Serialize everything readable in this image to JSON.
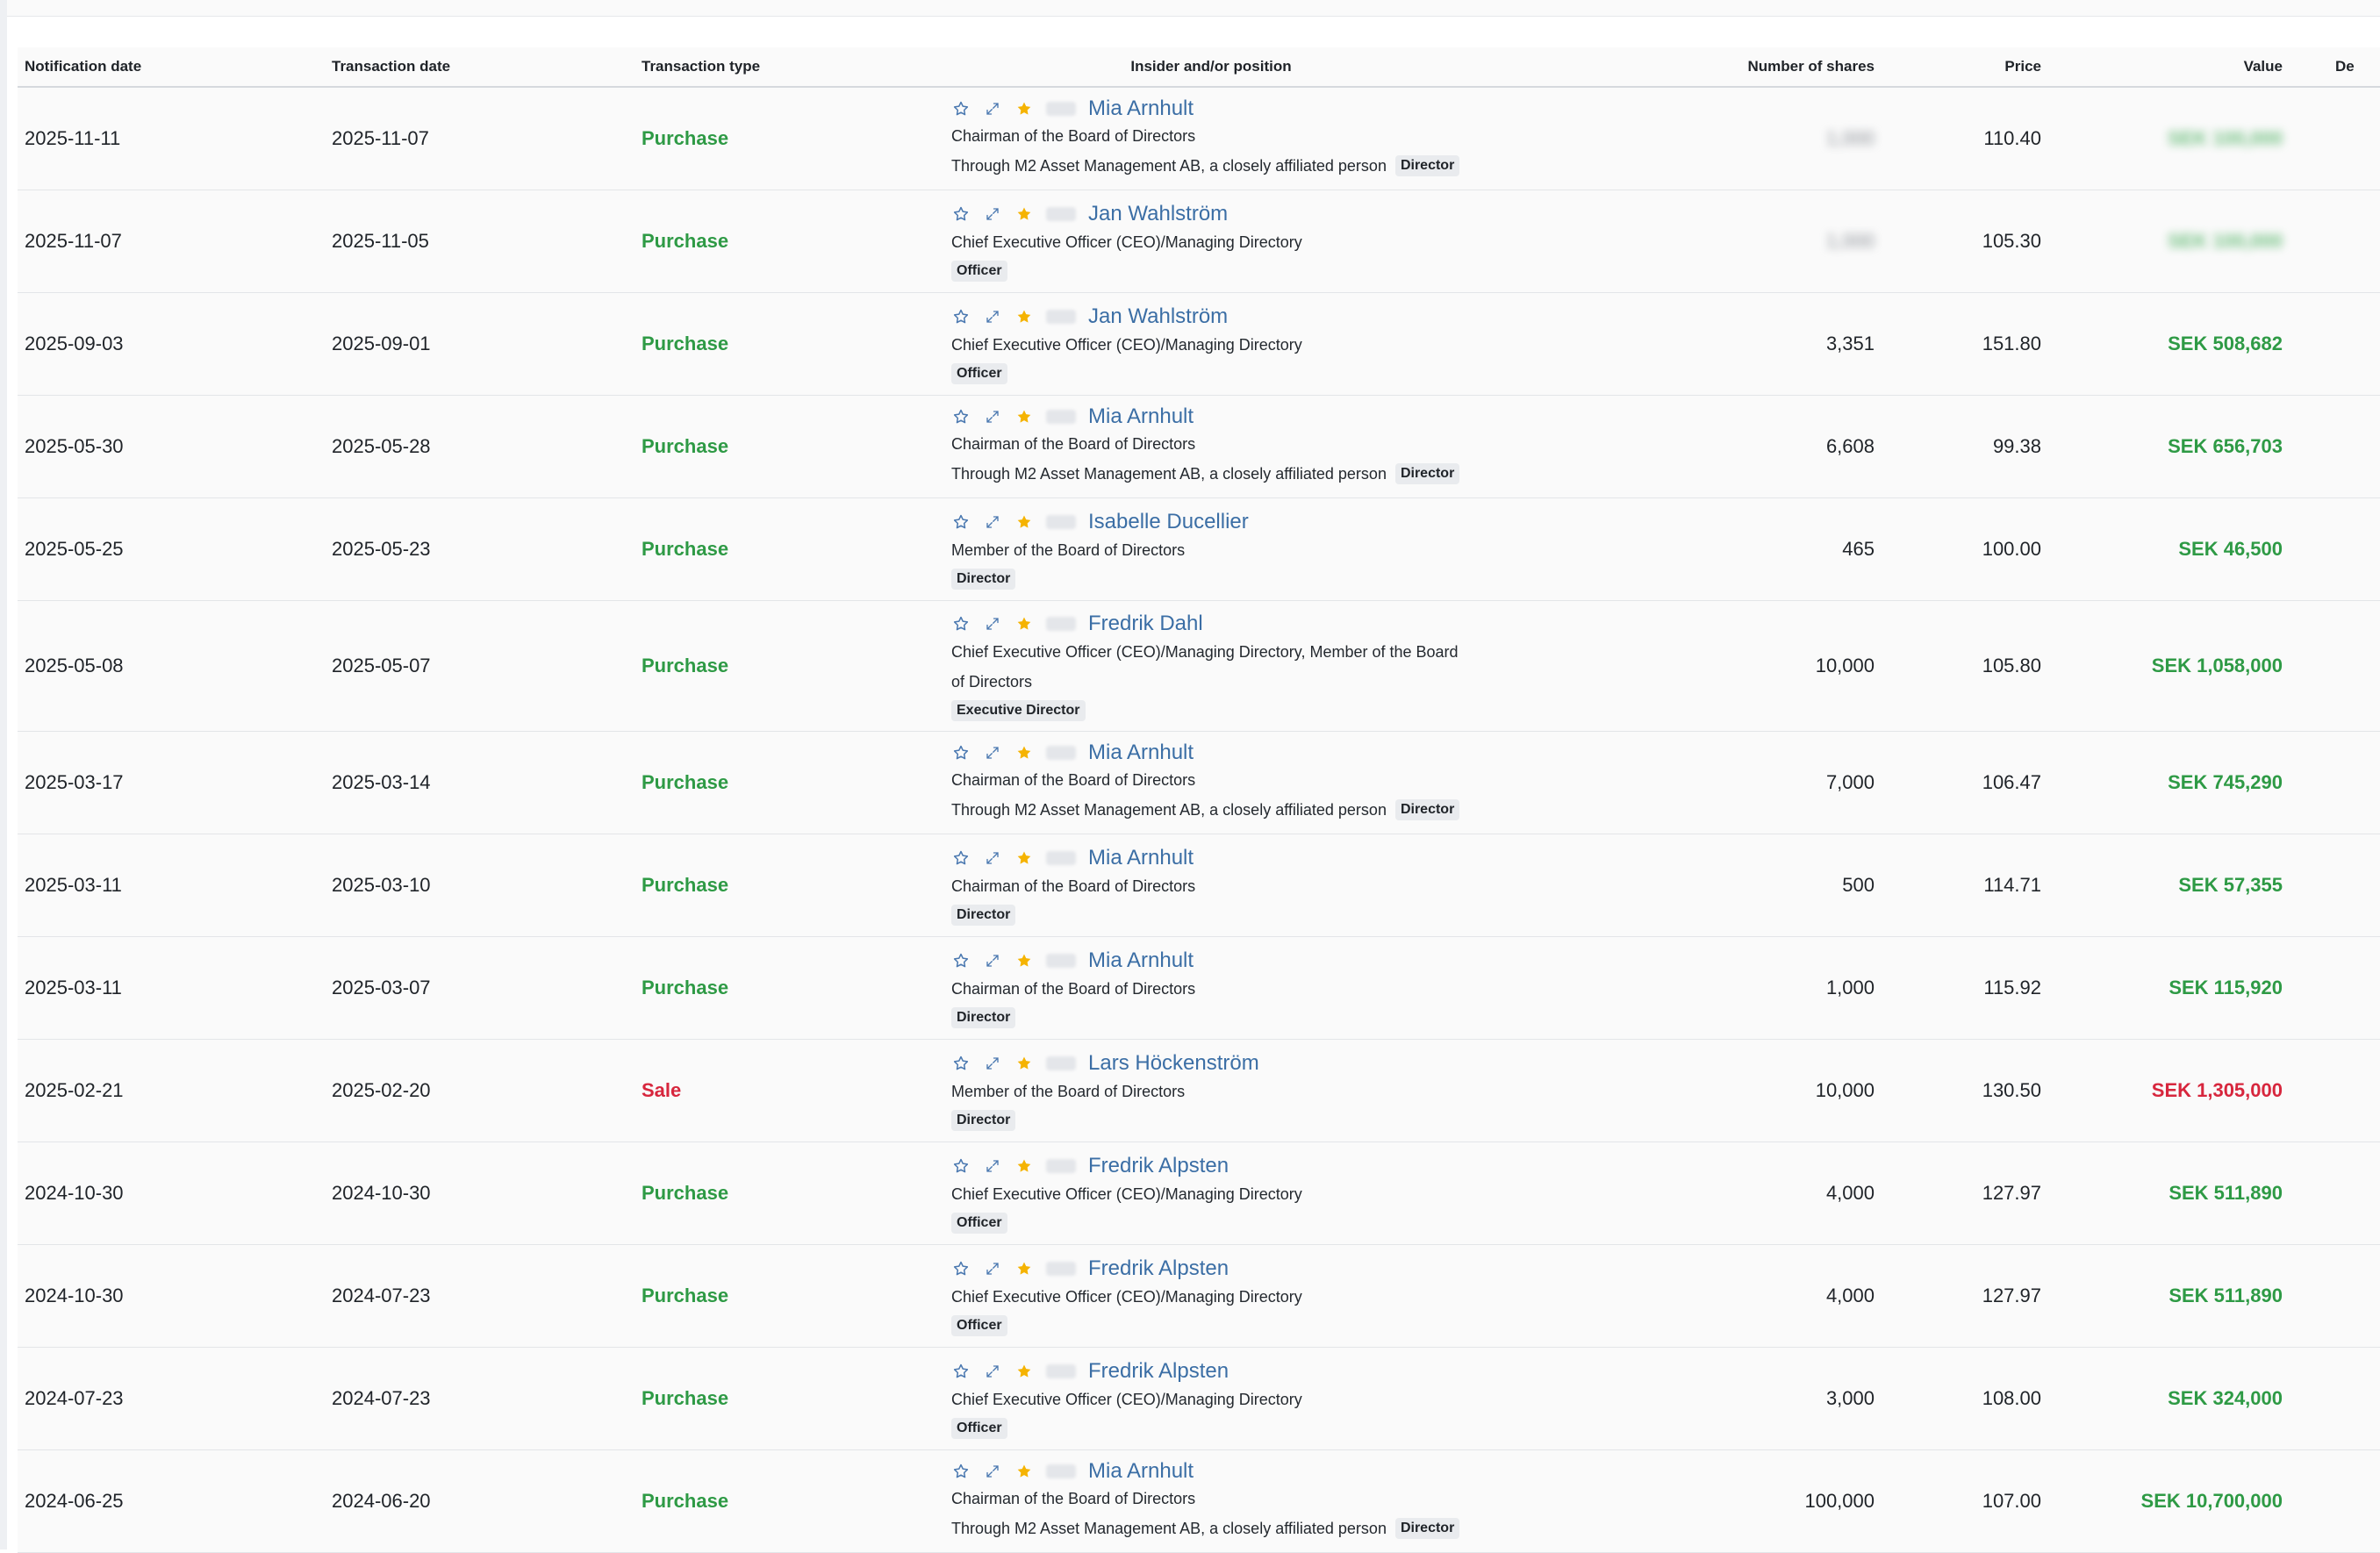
{
  "table": {
    "columns": {
      "notification_date": "Notification date",
      "transaction_date": "Transaction date",
      "transaction_type": "Transaction type",
      "insider": "Insider and/or position",
      "shares": "Number of shares",
      "price": "Price",
      "value": "Value",
      "extra": "De"
    },
    "rows": [
      {
        "notif": "2025-11-11",
        "trans": "2025-11-07",
        "type": "Purchase",
        "name": "Mia Arnhult",
        "position": "Chairman of the Board of Directors",
        "note": "Through M2 Asset Management AB, a closely affiliated person",
        "tag": "Director",
        "shares": "1,000",
        "price": "110.40",
        "value": "SEK 100,000",
        "blurred": true
      },
      {
        "notif": "2025-11-07",
        "trans": "2025-11-05",
        "type": "Purchase",
        "name": "Jan Wahlström",
        "position": "Chief Executive Officer (CEO)/Managing Directory",
        "note": "",
        "tag": "Officer",
        "shares": "1,000",
        "price": "105.30",
        "value": "SEK 100,000",
        "blurred": true
      },
      {
        "notif": "2025-09-03",
        "trans": "2025-09-01",
        "type": "Purchase",
        "name": "Jan Wahlström",
        "position": "Chief Executive Officer (CEO)/Managing Directory",
        "note": "",
        "tag": "Officer",
        "shares": "3,351",
        "price": "151.80",
        "value": "SEK 508,682",
        "blurred": false
      },
      {
        "notif": "2025-05-30",
        "trans": "2025-05-28",
        "type": "Purchase",
        "name": "Mia Arnhult",
        "position": "Chairman of the Board of Directors",
        "note": "Through M2 Asset Management AB, a closely affiliated person",
        "tag": "Director",
        "shares": "6,608",
        "price": "99.38",
        "value": "SEK 656,703",
        "blurred": false
      },
      {
        "notif": "2025-05-25",
        "trans": "2025-05-23",
        "type": "Purchase",
        "name": "Isabelle Ducellier",
        "position": "Member of the Board of Directors",
        "note": "",
        "tag": "Director",
        "shares": "465",
        "price": "100.00",
        "value": "SEK 46,500",
        "blurred": false
      },
      {
        "notif": "2025-05-08",
        "trans": "2025-05-07",
        "type": "Purchase",
        "name": "Fredrik Dahl",
        "position": "Chief Executive Officer (CEO)/Managing Directory, Member of the Board of Directors",
        "note": "",
        "tag": "Executive Director",
        "shares": "10,000",
        "price": "105.80",
        "value": "SEK 1,058,000",
        "blurred": false
      },
      {
        "notif": "2025-03-17",
        "trans": "2025-03-14",
        "type": "Purchase",
        "name": "Mia Arnhult",
        "position": "Chairman of the Board of Directors",
        "note": "Through M2 Asset Management AB, a closely affiliated person",
        "tag": "Director",
        "shares": "7,000",
        "price": "106.47",
        "value": "SEK 745,290",
        "blurred": false
      },
      {
        "notif": "2025-03-11",
        "trans": "2025-03-10",
        "type": "Purchase",
        "name": "Mia Arnhult",
        "position": "Chairman of the Board of Directors",
        "note": "",
        "tag": "Director",
        "shares": "500",
        "price": "114.71",
        "value": "SEK 57,355",
        "blurred": false
      },
      {
        "notif": "2025-03-11",
        "trans": "2025-03-07",
        "type": "Purchase",
        "name": "Mia Arnhult",
        "position": "Chairman of the Board of Directors",
        "note": "",
        "tag": "Director",
        "shares": "1,000",
        "price": "115.92",
        "value": "SEK 115,920",
        "blurred": false
      },
      {
        "notif": "2025-02-21",
        "trans": "2025-02-20",
        "type": "Sale",
        "name": "Lars Höckenström",
        "position": "Member of the Board of Directors",
        "note": "",
        "tag": "Director",
        "shares": "10,000",
        "price": "130.50",
        "value": "SEK 1,305,000",
        "blurred": false
      },
      {
        "notif": "2024-10-30",
        "trans": "2024-10-30",
        "type": "Purchase",
        "name": "Fredrik Alpsten",
        "position": "Chief Executive Officer (CEO)/Managing Directory",
        "note": "",
        "tag": "Officer",
        "shares": "4,000",
        "price": "127.97",
        "value": "SEK 511,890",
        "blurred": false
      },
      {
        "notif": "2024-10-30",
        "trans": "2024-07-23",
        "type": "Purchase",
        "name": "Fredrik Alpsten",
        "position": "Chief Executive Officer (CEO)/Managing Directory",
        "note": "",
        "tag": "Officer",
        "shares": "4,000",
        "price": "127.97",
        "value": "SEK 511,890",
        "blurred": false
      },
      {
        "notif": "2024-07-23",
        "trans": "2024-07-23",
        "type": "Purchase",
        "name": "Fredrik Alpsten",
        "position": "Chief Executive Officer (CEO)/Managing Directory",
        "note": "",
        "tag": "Officer",
        "shares": "3,000",
        "price": "108.00",
        "value": "SEK 324,000",
        "blurred": false
      },
      {
        "notif": "2024-06-25",
        "trans": "2024-06-20",
        "type": "Purchase",
        "name": "Mia Arnhult",
        "position": "Chairman of the Board of Directors",
        "note": "Through M2 Asset Management AB, a closely affiliated person",
        "tag": "Director",
        "shares": "100,000",
        "price": "107.00",
        "value": "SEK 10,700,000",
        "blurred": false
      }
    ]
  },
  "icons": {
    "watch": "star-outline-icon",
    "expand": "expand-icon",
    "favorite": "star-filled-icon"
  },
  "colors": {
    "purchase": "#2e9a45",
    "sale": "#d7263d",
    "link": "#3b6ea5",
    "star": "#f5b301"
  }
}
